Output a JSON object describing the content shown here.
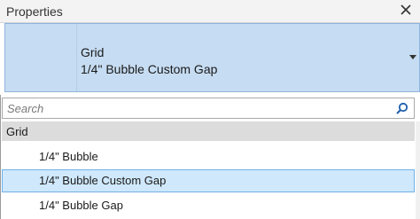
{
  "panel": {
    "title": "Properties"
  },
  "type_selector": {
    "family": "Grid",
    "type": "1/4\" Bubble Custom Gap"
  },
  "search": {
    "placeholder": "Search"
  },
  "dropdown": {
    "group_label": "Grid",
    "items": [
      {
        "label": "1/4\" Bubble",
        "selected": false
      },
      {
        "label": "1/4\" Bubble Custom Gap",
        "selected": true
      },
      {
        "label": "1/4\" Bubble Gap",
        "selected": false
      }
    ]
  },
  "colors": {
    "selector_bg": "#c6dcf2",
    "selected_item_bg": "#cfe8fb",
    "selected_item_border": "#6fb0e8",
    "accent_icon": "#1f5fae"
  }
}
